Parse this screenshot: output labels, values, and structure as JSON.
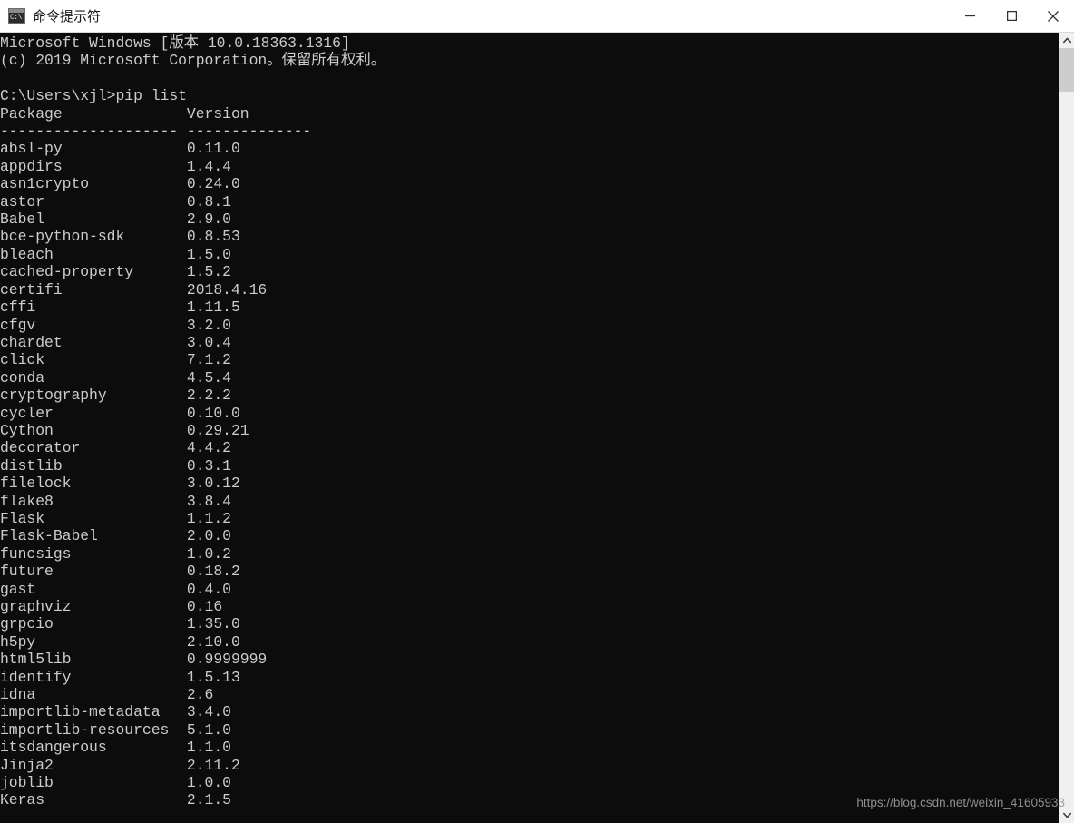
{
  "window": {
    "title": "命令提示符",
    "icon": "cmd-console-icon",
    "controls": {
      "minimize": "—",
      "maximize": "□",
      "close": "✕"
    }
  },
  "console": {
    "background_color": "#0c0c0c",
    "text_color": "#cccccc",
    "banner": [
      "Microsoft Windows [版本 10.0.18363.1316]",
      "(c) 2019 Microsoft Corporation。保留所有权利。",
      ""
    ],
    "prompt_line": "C:\\Users\\xjl>pip list",
    "columns": [
      "Package",
      "Version"
    ],
    "separator": "-------------------- --------------",
    "packages": [
      {
        "name": "absl-py",
        "version": "0.11.0"
      },
      {
        "name": "appdirs",
        "version": "1.4.4"
      },
      {
        "name": "asn1crypto",
        "version": "0.24.0"
      },
      {
        "name": "astor",
        "version": "0.8.1"
      },
      {
        "name": "Babel",
        "version": "2.9.0"
      },
      {
        "name": "bce-python-sdk",
        "version": "0.8.53"
      },
      {
        "name": "bleach",
        "version": "1.5.0"
      },
      {
        "name": "cached-property",
        "version": "1.5.2"
      },
      {
        "name": "certifi",
        "version": "2018.4.16"
      },
      {
        "name": "cffi",
        "version": "1.11.5"
      },
      {
        "name": "cfgv",
        "version": "3.2.0"
      },
      {
        "name": "chardet",
        "version": "3.0.4"
      },
      {
        "name": "click",
        "version": "7.1.2"
      },
      {
        "name": "conda",
        "version": "4.5.4"
      },
      {
        "name": "cryptography",
        "version": "2.2.2"
      },
      {
        "name": "cycler",
        "version": "0.10.0"
      },
      {
        "name": "Cython",
        "version": "0.29.21"
      },
      {
        "name": "decorator",
        "version": "4.4.2"
      },
      {
        "name": "distlib",
        "version": "0.3.1"
      },
      {
        "name": "filelock",
        "version": "3.0.12"
      },
      {
        "name": "flake8",
        "version": "3.8.4"
      },
      {
        "name": "Flask",
        "version": "1.1.2"
      },
      {
        "name": "Flask-Babel",
        "version": "2.0.0"
      },
      {
        "name": "funcsigs",
        "version": "1.0.2"
      },
      {
        "name": "future",
        "version": "0.18.2"
      },
      {
        "name": "gast",
        "version": "0.4.0"
      },
      {
        "name": "graphviz",
        "version": "0.16"
      },
      {
        "name": "grpcio",
        "version": "1.35.0"
      },
      {
        "name": "h5py",
        "version": "2.10.0"
      },
      {
        "name": "html5lib",
        "version": "0.9999999"
      },
      {
        "name": "identify",
        "version": "1.5.13"
      },
      {
        "name": "idna",
        "version": "2.6"
      },
      {
        "name": "importlib-metadata",
        "version": "3.4.0"
      },
      {
        "name": "importlib-resources",
        "version": "5.1.0"
      },
      {
        "name": "itsdangerous",
        "version": "1.1.0"
      },
      {
        "name": "Jinja2",
        "version": "2.11.2"
      },
      {
        "name": "joblib",
        "version": "1.0.0"
      },
      {
        "name": "Keras",
        "version": "2.1.5"
      }
    ]
  },
  "scrollbar": {
    "up_arrow": "⌃",
    "down_arrow": "⌄"
  },
  "watermark": {
    "text": "https://blog.csdn.net/weixin_41605933"
  }
}
